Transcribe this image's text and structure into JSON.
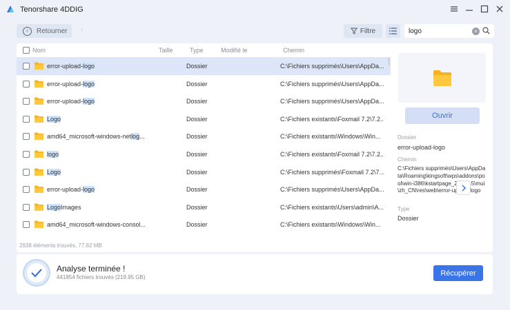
{
  "window": {
    "title": "Tenorshare 4DDIG"
  },
  "toolbar": {
    "back_label": "Retourner",
    "filter_label": "Filtre"
  },
  "search": {
    "value": "logo"
  },
  "table": {
    "headers": {
      "name": "Nom",
      "size": "Taille",
      "type": "Type",
      "modified": "Modifié le",
      "path": "Chemin"
    },
    "rows": [
      {
        "name_pre": "error-upload-",
        "name_hl": "logo",
        "name_post": "",
        "type": "Dossier",
        "path": "C:\\Fichiers supprimés\\Users\\AppDa...",
        "selected": true
      },
      {
        "name_pre": "error-upload-",
        "name_hl": "logo",
        "name_post": "",
        "type": "Dossier",
        "path": "C:\\Fichiers supprimés\\Users\\AppDa..."
      },
      {
        "name_pre": "error-upload-",
        "name_hl": "logo",
        "name_post": "",
        "type": "Dossier",
        "path": "C:\\Fichiers supprimés\\Users\\AppDa..."
      },
      {
        "name_pre": "",
        "name_hl": "Logo",
        "name_post": "",
        "type": "Dossier",
        "path": "C:\\Fichiers existants\\Foxmail 7.2\\7.2..."
      },
      {
        "name_pre": "amd64_microsoft-windows-net",
        "name_hl": "log",
        "name_post": "...",
        "type": "Dossier",
        "path": "C:\\Fichiers existants\\Windows\\Win..."
      },
      {
        "name_pre": "",
        "name_hl": "logo",
        "name_post": "",
        "type": "Dossier",
        "path": "C:\\Fichiers existants\\Foxmail 7.2\\7.2..."
      },
      {
        "name_pre": "",
        "name_hl": "Logo",
        "name_post": "",
        "type": "Dossier",
        "path": "C:\\Fichiers supprimés\\Foxmail 7.2\\7..."
      },
      {
        "name_pre": "error-upload-",
        "name_hl": "logo",
        "name_post": "",
        "type": "Dossier",
        "path": "C:\\Fichiers supprimés\\Users\\AppDa..."
      },
      {
        "name_pre": "",
        "name_hl": "Logo",
        "name_post": "Images",
        "type": "Dossier",
        "path": "C:\\Fichiers existants\\Users\\admin\\A..."
      },
      {
        "name_pre": "amd64_microsoft-windows-consol...",
        "name_hl": "",
        "name_post": "",
        "type": "Dossier",
        "path": "C:\\Fichiers existants\\Windows\\Win..."
      }
    ],
    "summary": "2938 éléments trouvés, 77.82 MB"
  },
  "details": {
    "open_label": "Ouvrir",
    "folder_label": "Dossier",
    "folder_value": "error-upload-logo",
    "path_label": "Chemin",
    "path_value": "C:\\Fichiers supprimés\\Users\\AppData\\Roaming\\kingsoft\\wps\\addons\\pool\\win-i386\\kstartpage_2.2.0.15\\mui\\zh_CN\\res\\web\\error-upload-logo",
    "type_label": "Type",
    "type_value": "Dossier"
  },
  "status": {
    "title": "Analyse terminée !",
    "subtitle": "441854 fichiers trouvés (219.95 GB)",
    "recover_label": "Récupérer"
  },
  "colors": {
    "accent": "#3a74e6",
    "selected_row": "#dce6f8",
    "highlight": "#cde2fb",
    "folder": "#f5b324"
  }
}
